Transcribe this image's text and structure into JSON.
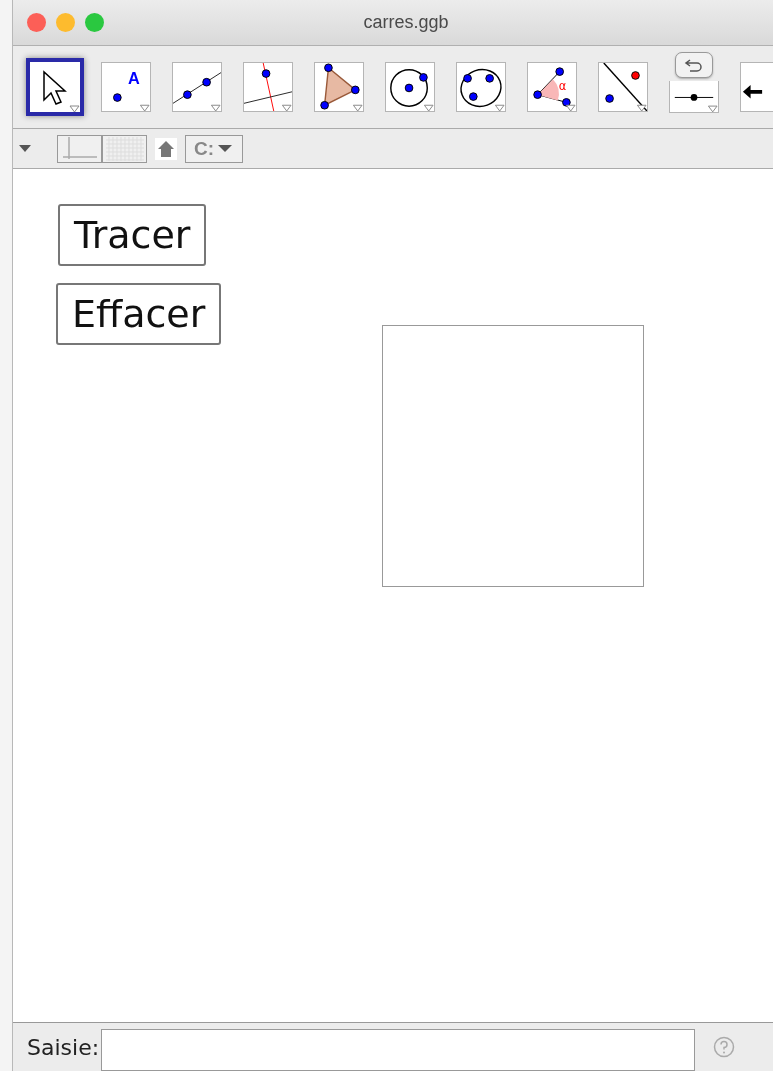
{
  "window": {
    "title": "carres.ggb"
  },
  "toolbar": {
    "tools": [
      {
        "kind": "move",
        "selected": true
      },
      {
        "kind": "point",
        "selected": false,
        "glyph": "A"
      },
      {
        "kind": "line",
        "selected": false
      },
      {
        "kind": "perpendicular",
        "selected": false
      },
      {
        "kind": "polygon",
        "selected": false
      },
      {
        "kind": "circle",
        "selected": false
      },
      {
        "kind": "conic",
        "selected": false
      },
      {
        "kind": "angle",
        "selected": false,
        "glyph": "α"
      },
      {
        "kind": "reflect",
        "selected": false
      },
      {
        "kind": "slider",
        "selected": false
      },
      {
        "kind": "move-view",
        "selected": false
      }
    ]
  },
  "style_bar": {
    "toggles": [
      {
        "kind": "axes",
        "selected": false
      },
      {
        "kind": "grid",
        "selected": false
      }
    ],
    "capture": "C:"
  },
  "canvas": {
    "buttons": [
      "Tracer",
      "Effacer"
    ],
    "shapes": [
      {
        "kind": "square"
      }
    ]
  },
  "input_bar": {
    "label": "Saisie:"
  }
}
